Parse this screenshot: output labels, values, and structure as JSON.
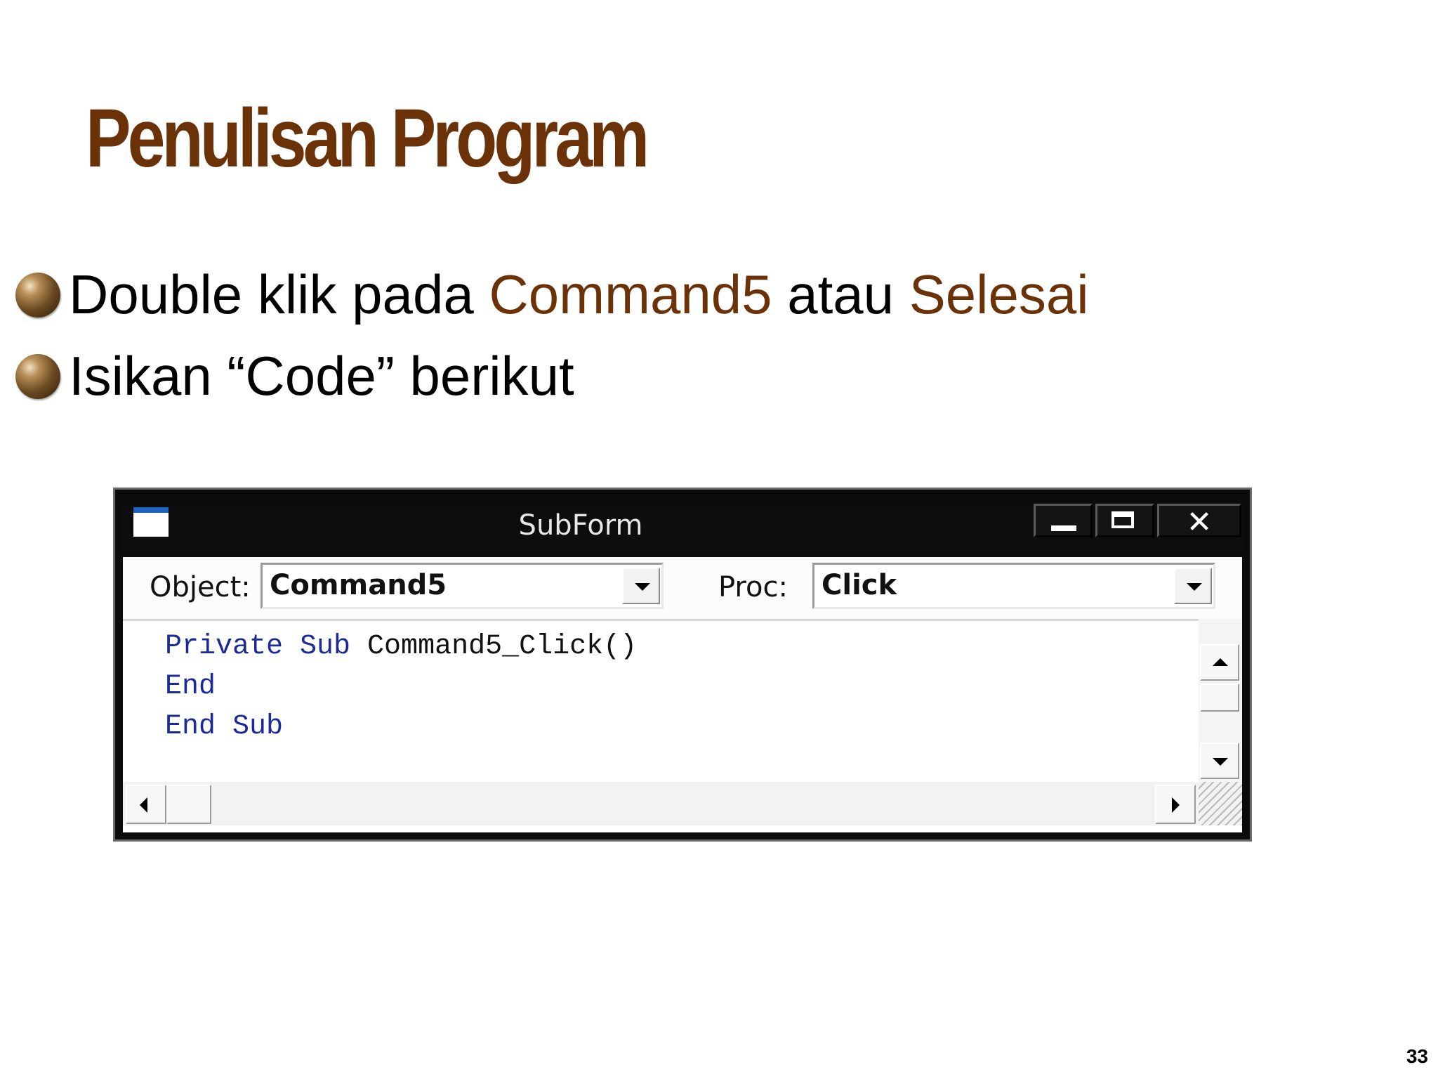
{
  "slide": {
    "title": "Penulisan Program",
    "page_number": "33"
  },
  "bullets": [
    {
      "icon": "sphere-bullet-icon",
      "text_before": "Double klik pada ",
      "highlight_1": "Command5",
      "text_middle": " atau ",
      "highlight_2": "Selesai"
    },
    {
      "icon": "sphere-bullet-icon",
      "text": "Isikan “Code” berikut"
    }
  ],
  "code_window": {
    "title": "SubForm",
    "object_label": "Object:",
    "object_value": "Command5",
    "proc_label": "Proc:",
    "proc_value": "Click",
    "code_lines": [
      {
        "keyword": "Private Sub",
        "rest": " Command5_Click()"
      },
      {
        "keyword": "End",
        "rest": ""
      },
      {
        "keyword": "End Sub",
        "rest": ""
      }
    ]
  },
  "colors": {
    "title": "#6b3208",
    "highlight": "#6b3208",
    "code_keyword": "#1c2a96",
    "titlebar": "#0d0d0d"
  }
}
